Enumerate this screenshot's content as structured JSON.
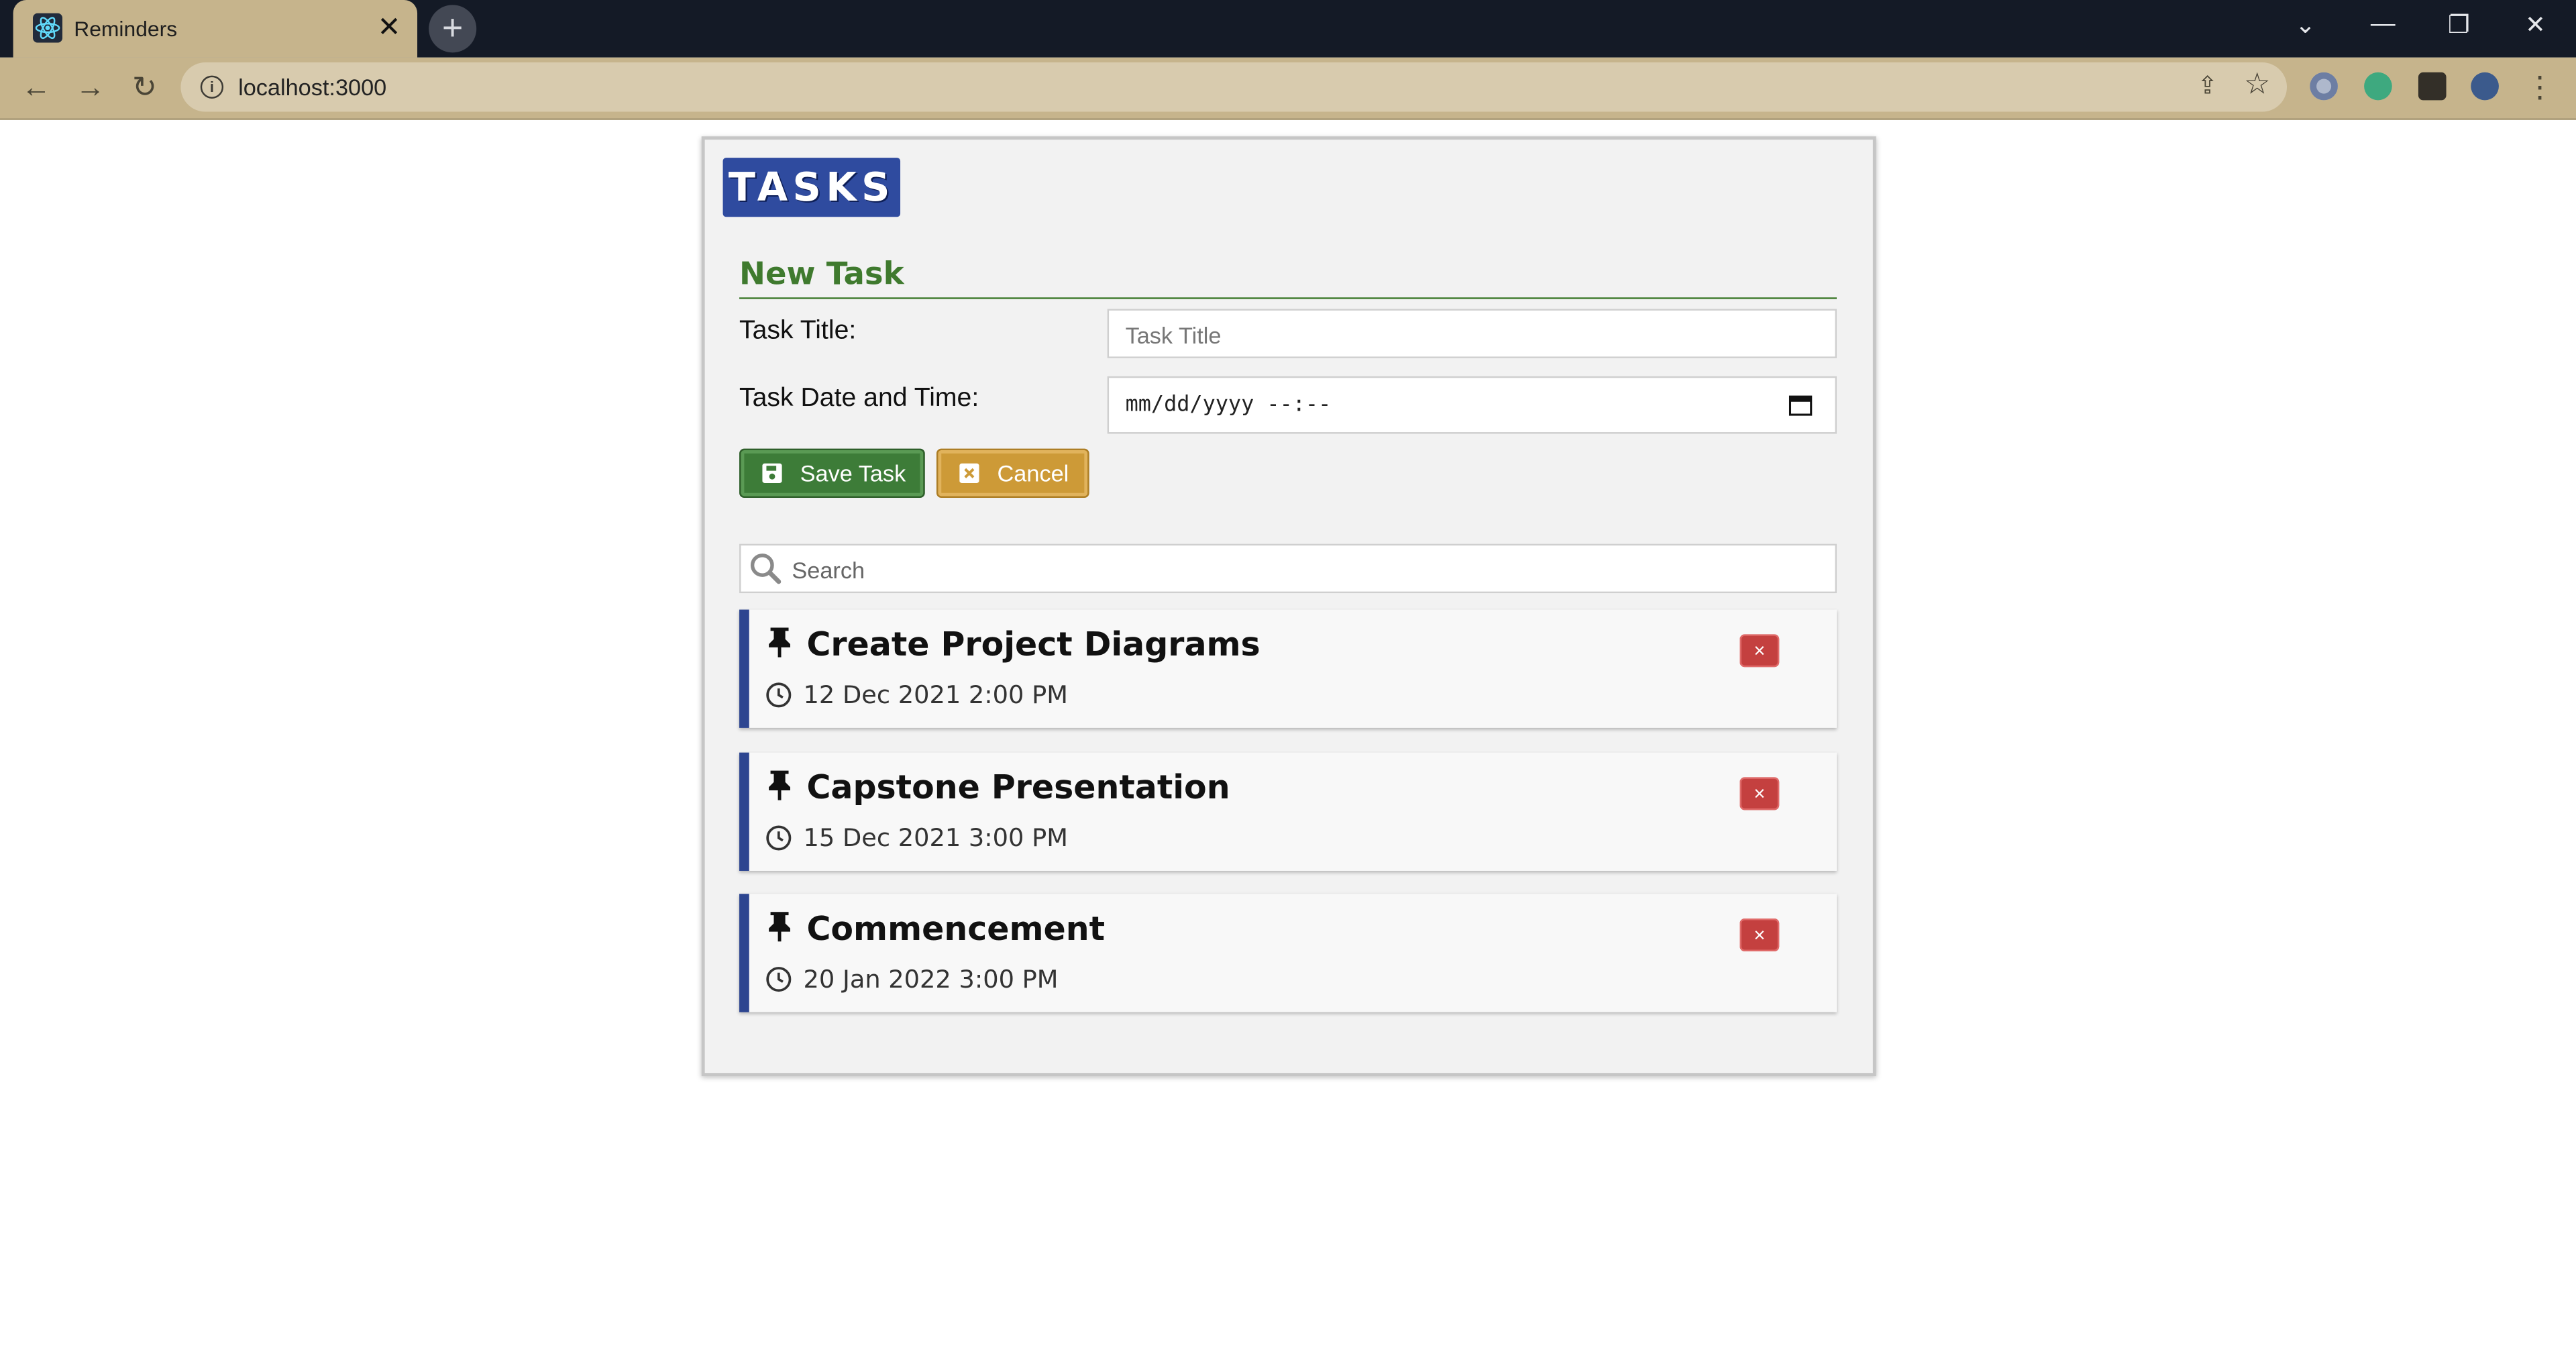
{
  "browser": {
    "tab_title": "Reminders",
    "tab_close": "✕",
    "new_tab": "+",
    "url": "localhost:3000",
    "window_controls": [
      "⌄",
      "—",
      "❐",
      "✕"
    ]
  },
  "app": {
    "logo": "TASKS",
    "form": {
      "section_title": "New Task",
      "title_label": "Task Title:",
      "title_placeholder": "Task Title",
      "date_label": "Task Date and Time:",
      "date_placeholder": "mm/dd/yyyy --:--",
      "save_label": "Save Task",
      "cancel_label": "Cancel"
    },
    "search_placeholder": "Search",
    "tasks": [
      {
        "title": "Create Project Diagrams",
        "datetime": "12 Dec 2021 2:00 PM"
      },
      {
        "title": "Capstone Presentation",
        "datetime": "15 Dec 2021 3:00 PM"
      },
      {
        "title": "Commencement",
        "datetime": "20 Jan 2022 3:00 PM"
      }
    ],
    "delete_label": "×"
  },
  "colors": {
    "logo_bg": "#2f4b9f",
    "section_green": "#3f7a2e",
    "save_green": "#3d7c38",
    "cancel_orange": "#cd9a37",
    "delete_red": "#c4403f",
    "task_accent": "#2d4590",
    "browser_chrome": "#c6b48c"
  }
}
